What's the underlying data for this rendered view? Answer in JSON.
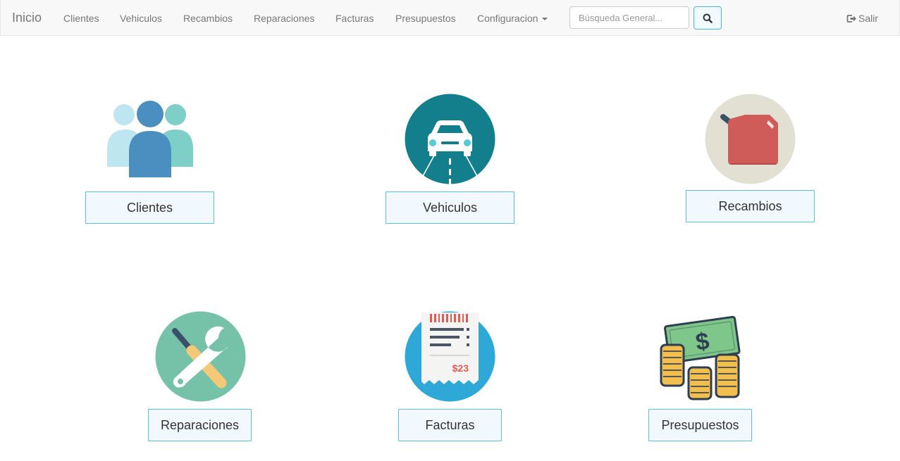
{
  "navbar": {
    "brand": "Inicio",
    "links": [
      "Clientes",
      "Vehiculos",
      "Recambios",
      "Reparaciones",
      "Facturas",
      "Presupuestos"
    ],
    "config_label": "Configuracion",
    "search": {
      "placeholder": "Búsqueda General...",
      "value": ""
    },
    "logout_label": "Salir"
  },
  "tiles": [
    {
      "label": "Clientes",
      "icon": "users-icon"
    },
    {
      "label": "Vehiculos",
      "icon": "car-icon"
    },
    {
      "label": "Recambios",
      "icon": "fuel-can-icon"
    },
    {
      "label": "Reparaciones",
      "icon": "tools-icon"
    },
    {
      "label": "Facturas",
      "icon": "receipt-icon",
      "receipt_amount": "$23"
    },
    {
      "label": "Presupuestos",
      "icon": "money-icon",
      "money_symbol": "$"
    }
  ],
  "colors": {
    "navbar_bg": "#f8f8f8",
    "button_border": "#5bc0de",
    "button_bg": "#f1f9fe",
    "teal": "#137f8c",
    "red": "#d05c5a",
    "green": "#76c2a8",
    "blue": "#2ea8d6"
  }
}
